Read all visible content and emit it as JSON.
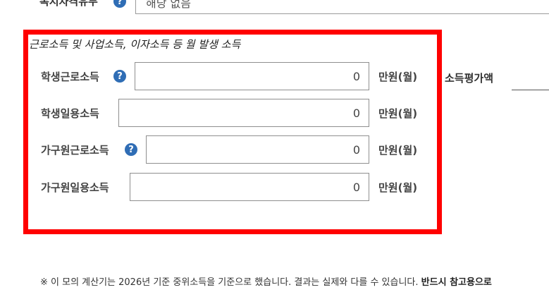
{
  "top_row": {
    "label": "복지자격유무",
    "help_icon": "?",
    "select_value": "해당 없음"
  },
  "section": {
    "title": "근로소득 및 사업소득, 이자소득 등 월 발생 소득",
    "rows": [
      {
        "label": "학생근로소득",
        "value": "0",
        "unit": "만원(월)",
        "help_icon": "?"
      },
      {
        "label": "학생일용소득",
        "value": "0",
        "unit": "만원(월)"
      },
      {
        "label": "가구원근로소득",
        "value": "0",
        "unit": "만원(월)",
        "help_icon": "?"
      },
      {
        "label": "가구원일용소득",
        "value": "0",
        "unit": "만원(월)"
      }
    ]
  },
  "evaluation": {
    "label": "소득평가액"
  },
  "note": {
    "text": "※ 이 모의 계산기는 2026년 기준 중위소득을 기준으로 했습니다. 결과는 실제와 다를 수 있습니다.",
    "bold_text": "반드시 참고용으로"
  },
  "colors": {
    "highlight_border": "#ff0000",
    "help_icon_bg": "#2f6db5"
  }
}
